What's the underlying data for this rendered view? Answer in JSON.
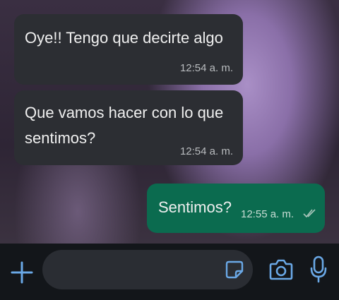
{
  "messages": [
    {
      "direction": "incoming",
      "text": "Oye!! Tengo que decirte algo",
      "time": "12:54 a. m."
    },
    {
      "direction": "incoming",
      "text": "Que vamos hacer con lo que\nsentimos?",
      "time": "12:54 a. m."
    },
    {
      "direction": "outgoing",
      "text": "Sentimos?",
      "time": "12:55 a. m.",
      "status_icon": "double-check-icon"
    }
  ],
  "input": {
    "value": "",
    "placeholder": ""
  },
  "icons": {
    "attach": "plus-icon",
    "sticker": "sticker-icon",
    "camera": "camera-icon",
    "voice": "mic-icon"
  },
  "colors": {
    "incoming_bubble": "#2c2e33",
    "outgoing_bubble": "#0b6b4f",
    "input_bar": "#13161a",
    "accent_icon": "#6aa8e6"
  }
}
